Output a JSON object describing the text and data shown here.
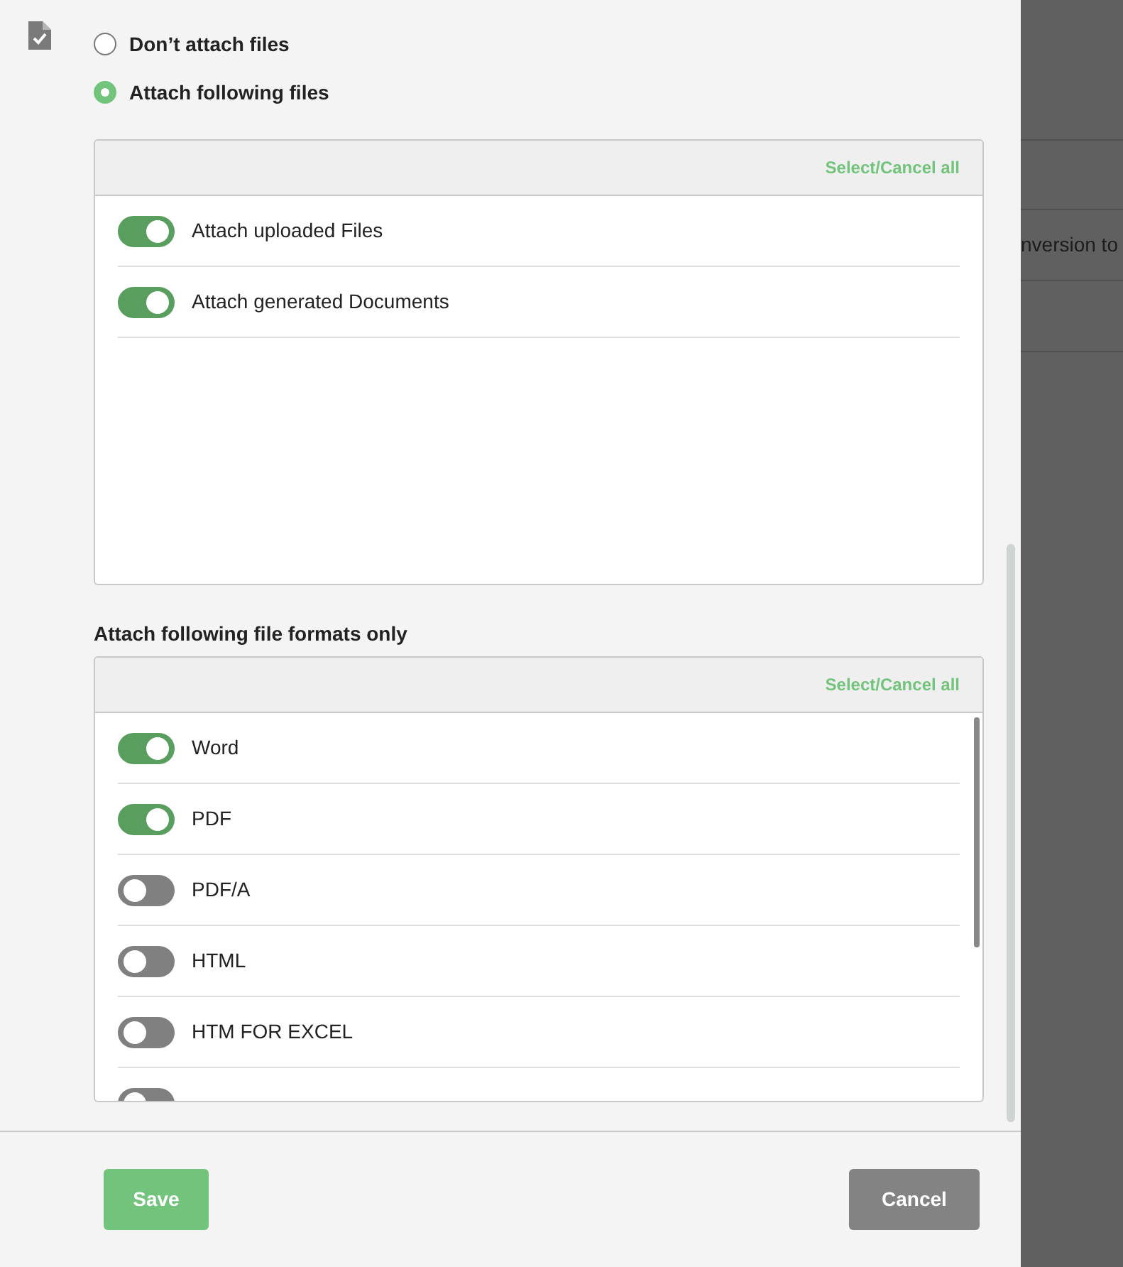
{
  "radios": [
    {
      "label": "Don’t attach files",
      "selected": false
    },
    {
      "label": "Attach following files",
      "selected": true
    }
  ],
  "files_panel": {
    "select_all": "Select/Cancel all",
    "items": [
      {
        "label": "Attach uploaded Files",
        "on": true
      },
      {
        "label": "Attach generated Documents",
        "on": true
      }
    ]
  },
  "formats_panel": {
    "title": "Attach following file formats only",
    "select_all": "Select/Cancel all",
    "items": [
      {
        "label": "Word",
        "on": true
      },
      {
        "label": "PDF",
        "on": true
      },
      {
        "label": "PDF/A",
        "on": false
      },
      {
        "label": "HTML",
        "on": false
      },
      {
        "label": "HTM FOR EXCEL",
        "on": false
      },
      {
        "on": false
      }
    ]
  },
  "buttons": [
    {
      "label": "Save",
      "kind": "primary"
    },
    {
      "label": "Cancel",
      "kind": "secondary"
    }
  ],
  "background": {
    "text": "nversion to"
  }
}
